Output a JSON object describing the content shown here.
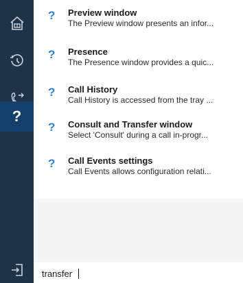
{
  "sidebar": {
    "items": [
      {
        "icon": "home-icon"
      },
      {
        "icon": "history-clock-icon"
      },
      {
        "icon": "call-transfer-icon"
      },
      {
        "icon": "help-icon",
        "label": "?"
      }
    ],
    "bottom": {
      "icon": "sign-out-icon"
    }
  },
  "results": [
    {
      "icon": "?",
      "title": "Preview window",
      "desc": "The Preview window presents an infor..."
    },
    {
      "icon": "?",
      "title": "Presence",
      "desc": "The Presence window provides a quic..."
    },
    {
      "icon": "?",
      "title": "Call History",
      "desc": "Call History is accessed from the tray ..."
    },
    {
      "icon": "?",
      "title": "Consult and Transfer window",
      "desc": "Select 'Consult' during a call in-progr..."
    },
    {
      "icon": "?",
      "title": "Call Events settings",
      "desc": "Call Events allows configuration relati..."
    }
  ],
  "search": {
    "value": "transfer"
  },
  "colors": {
    "sidebar": "#1f3348",
    "sidebar_active": "#14406b",
    "help_icon": "#2f7fd0"
  }
}
